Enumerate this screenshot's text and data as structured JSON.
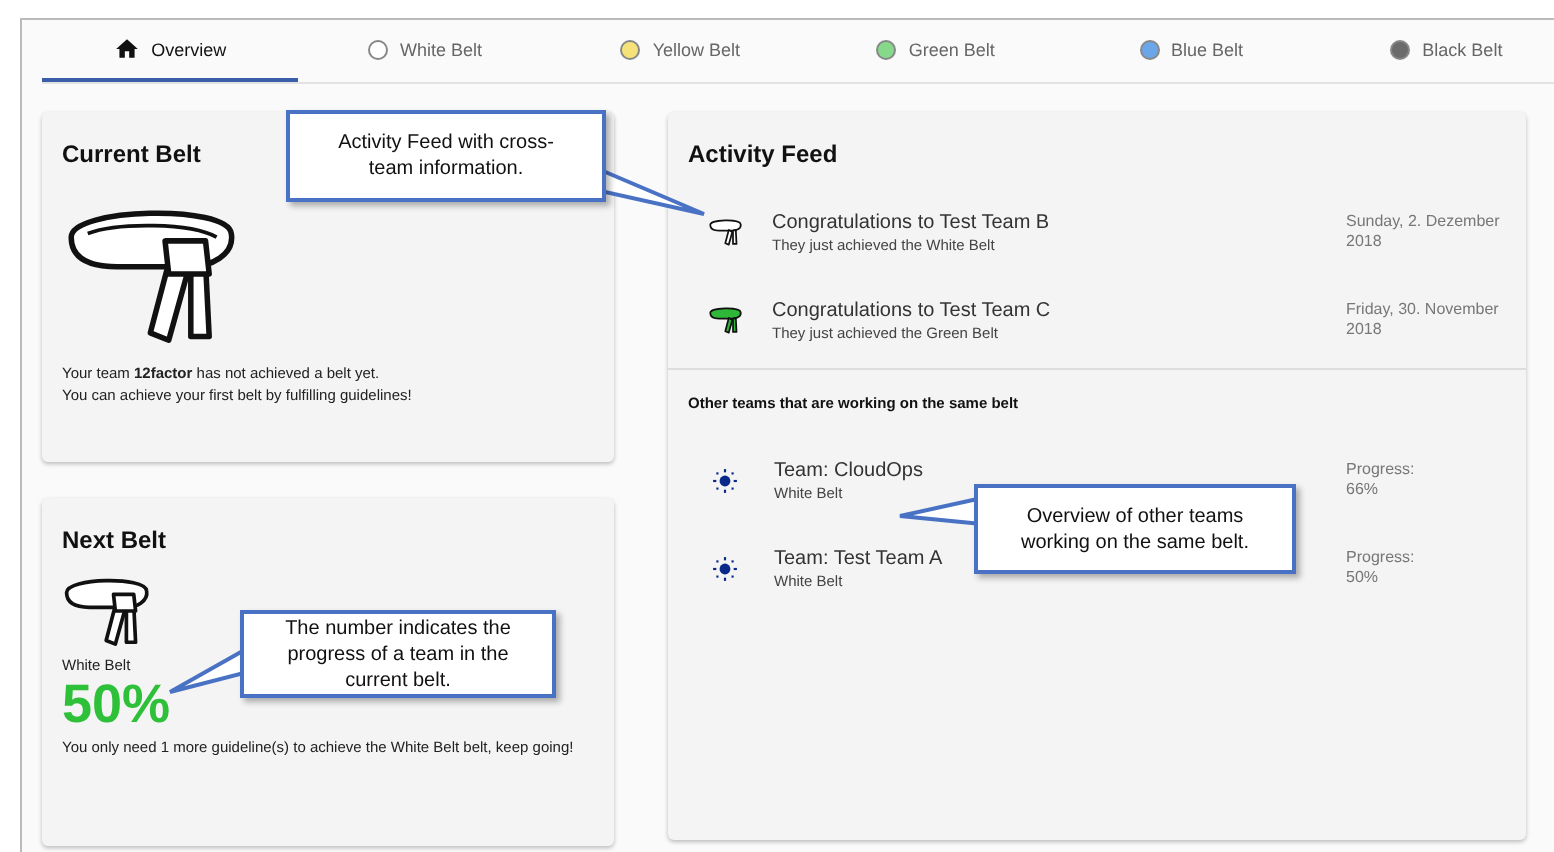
{
  "tabs": [
    {
      "label": "Overview",
      "kind": "home",
      "selected": true
    },
    {
      "label": "White Belt",
      "kind": "belt",
      "color": "#ffffff",
      "selected": false
    },
    {
      "label": "Yellow Belt",
      "kind": "belt",
      "color": "#f7e27a",
      "selected": false
    },
    {
      "label": "Green Belt",
      "kind": "belt",
      "color": "#86d98a",
      "selected": false
    },
    {
      "label": "Blue Belt",
      "kind": "belt",
      "color": "#6aa6e8",
      "selected": false
    },
    {
      "label": "Black Belt",
      "kind": "belt",
      "color": "#6b6b6b",
      "selected": false
    }
  ],
  "current_belt": {
    "title": "Current Belt",
    "message": "Your team **12factor** has not achieved a belt yet.",
    "hint": "You can achieve your first belt by fulfilling guidelines!"
  },
  "next_belt": {
    "title": "Next Belt",
    "belt_name": "White Belt",
    "progress": "50%",
    "message": "You only need 1 more guideline(s) to achieve the White Belt belt, keep going!"
  },
  "activity_feed": {
    "title": "Activity Feed",
    "items": [
      {
        "title": "Congratulations to Test Team B",
        "subtitle": "They just achieved the White Belt",
        "date": "Sunday, 2. Dezember 2018",
        "color": "#ffffff"
      },
      {
        "title": "Congratulations to Test Team C",
        "subtitle": "They just achieved the Green Belt",
        "date": "Friday, 30. November 2018",
        "color": "#2fb838"
      }
    ],
    "other_teams_title": "Other teams that are working on the same belt",
    "other_teams": [
      {
        "name": "Team: CloudOps",
        "belt": "White Belt",
        "progress_label": "Progress:",
        "progress": "66%"
      },
      {
        "name": "Team: Test Team A",
        "belt": "White Belt",
        "progress_label": "Progress:",
        "progress": "50%"
      }
    ]
  },
  "annotations": [
    {
      "text": "Activity Feed with cross-team information."
    },
    {
      "text": "The number indicates the progress of a team in the current belt."
    },
    {
      "text": "Overview of other teams working on the same belt."
    }
  ]
}
